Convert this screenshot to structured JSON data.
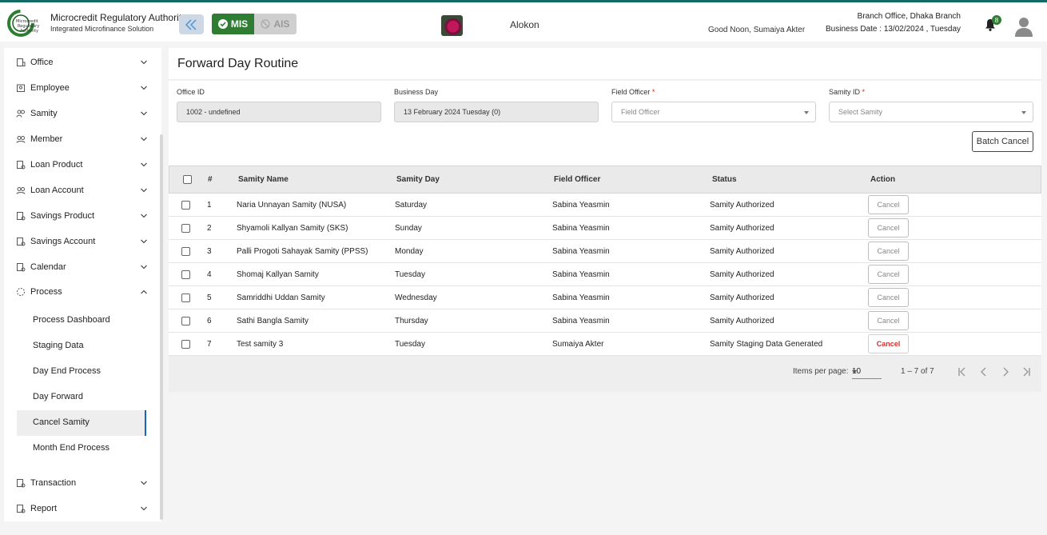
{
  "brand": {
    "logo_text": "Microcredit Regulatory Authority",
    "title": "Microcredit Regulatory Authority",
    "subtitle": "Integrated Microfinance Solution"
  },
  "header": {
    "mode_mis": "MIS",
    "mode_ais": "AIS",
    "center_name": "Alokon",
    "greeting": "Good Noon, Sumaiya Akter",
    "branch": "Branch Office, Dhaka Branch",
    "business_date": "Business Date : 13/02/2024 , Tuesday",
    "notification_count": "8"
  },
  "sidebar": {
    "items": [
      {
        "label": "Office",
        "icon": "building-icon",
        "expanded": false
      },
      {
        "label": "Employee",
        "icon": "employee-icon",
        "expanded": false
      },
      {
        "label": "Samity",
        "icon": "group-icon",
        "expanded": false
      },
      {
        "label": "Member",
        "icon": "members-icon",
        "expanded": false
      },
      {
        "label": "Loan Product",
        "icon": "document-icon",
        "expanded": false
      },
      {
        "label": "Loan Account",
        "icon": "members-icon",
        "expanded": false
      },
      {
        "label": "Savings Product",
        "icon": "document-icon",
        "expanded": false
      },
      {
        "label": "Savings Account",
        "icon": "document-icon",
        "expanded": false
      },
      {
        "label": "Calendar",
        "icon": "document-icon",
        "expanded": false
      },
      {
        "label": "Process",
        "icon": "loading-icon",
        "expanded": true
      }
    ],
    "process_children": [
      "Process Dashboard",
      "Staging Data",
      "Day End Process",
      "Day Forward",
      "Cancel Samity",
      "Month End Process"
    ],
    "active_child": "Cancel Samity",
    "bottom_items": [
      {
        "label": "Transaction",
        "icon": "document-icon",
        "expanded": false
      },
      {
        "label": "Report",
        "icon": "document-icon",
        "expanded": false
      }
    ]
  },
  "page": {
    "title": "Forward Day Routine",
    "fields": {
      "office_id": {
        "label": "Office ID",
        "value": "1002 - undefined"
      },
      "business_day": {
        "label": "Business Day",
        "value": "13 February 2024 Tuesday (0)"
      },
      "field_officer": {
        "label": "Field Officer",
        "required_mark": "*",
        "placeholder": "Field Officer"
      },
      "samity_id": {
        "label": "Samity ID",
        "required_mark": "*",
        "placeholder": "Select Samity"
      }
    },
    "batch_cancel": "Batch Cancel"
  },
  "table": {
    "headers": [
      "#",
      "Samity Name",
      "Samity Day",
      "Field Officer",
      "Status",
      "Action"
    ],
    "rows": [
      {
        "num": "1",
        "name": "Naria Unnayan Samity (NUSA)",
        "day": "Saturday",
        "officer": "Sabina Yeasmin",
        "status": "Samity Authorized",
        "action": "Cancel",
        "action_enabled": false
      },
      {
        "num": "2",
        "name": "Shyamoli Kallyan Samity (SKS)",
        "day": "Sunday",
        "officer": "Sabina Yeasmin",
        "status": "Samity Authorized",
        "action": "Cancel",
        "action_enabled": false
      },
      {
        "num": "3",
        "name": "Palli Progoti Sahayak Samity (PPSS)",
        "day": "Monday",
        "officer": "Sabina Yeasmin",
        "status": "Samity Authorized",
        "action": "Cancel",
        "action_enabled": false
      },
      {
        "num": "4",
        "name": "Shomaj Kallyan Samity",
        "day": "Tuesday",
        "officer": "Sabina Yeasmin",
        "status": "Samity Authorized",
        "action": "Cancel",
        "action_enabled": false
      },
      {
        "num": "5",
        "name": "Samriddhi Uddan Samity",
        "day": "Wednesday",
        "officer": "Sabina Yeasmin",
        "status": "Samity Authorized",
        "action": "Cancel",
        "action_enabled": false
      },
      {
        "num": "6",
        "name": "Sathi Bangla Samity",
        "day": "Thursday",
        "officer": "Sabina Yeasmin",
        "status": "Samity Authorized",
        "action": "Cancel",
        "action_enabled": false
      },
      {
        "num": "7",
        "name": "Test samity 3",
        "day": "Tuesday",
        "officer": "Sumaiya Akter",
        "status": "Samity Staging Data Generated",
        "action": "Cancel",
        "action_enabled": true
      }
    ]
  },
  "paginator": {
    "label": "Items per page:",
    "page_size": "10",
    "range": "1 – 7 of 7"
  },
  "colors": {
    "accent": "#2e7d32",
    "danger": "#d32f2f",
    "active_border": "#1565c0",
    "collapse_bg": "#cdd8e4"
  }
}
